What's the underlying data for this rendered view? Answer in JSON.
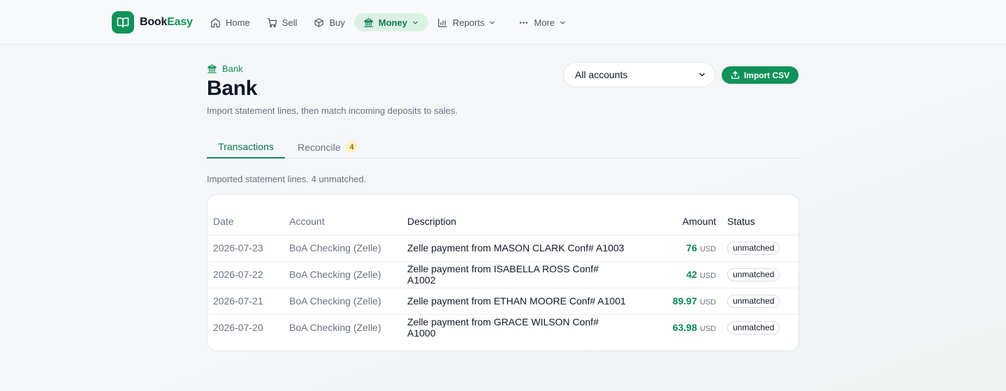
{
  "brand": {
    "name_part1": "Book",
    "name_part2": "Easy"
  },
  "nav": {
    "home": "Home",
    "sell": "Sell",
    "buy": "Buy",
    "money": "Money",
    "reports": "Reports",
    "more": "More"
  },
  "header": {
    "breadcrumb": "Bank",
    "title": "Bank",
    "subtitle": "Import statement lines, then match incoming deposits to sales.",
    "account_select": "All accounts",
    "import_button": "Import CSV"
  },
  "tabs": {
    "transactions": "Transactions",
    "reconcile": "Reconcile",
    "reconcile_count": "4"
  },
  "summary": "Imported statement lines. 4 unmatched.",
  "table": {
    "headers": {
      "date": "Date",
      "account": "Account",
      "description": "Description",
      "amount": "Amount",
      "status": "Status"
    },
    "rows": [
      {
        "date": "2026-07-23",
        "account": "BoA Checking (Zelle)",
        "description": "Zelle payment from MASON CLARK Conf# A1003",
        "amount": "76",
        "currency": "USD",
        "status": "unmatched"
      },
      {
        "date": "2026-07-22",
        "account": "BoA Checking (Zelle)",
        "description": "Zelle payment from ISABELLA ROSS Conf# A1002",
        "amount": "42",
        "currency": "USD",
        "status": "unmatched"
      },
      {
        "date": "2026-07-21",
        "account": "BoA Checking (Zelle)",
        "description": "Zelle payment from ETHAN MOORE Conf# A1001",
        "amount": "89.97",
        "currency": "USD",
        "status": "unmatched"
      },
      {
        "date": "2026-07-20",
        "account": "BoA Checking (Zelle)",
        "description": "Zelle payment from GRACE WILSON Conf# A1000",
        "amount": "63.98",
        "currency": "USD",
        "status": "unmatched"
      }
    ]
  },
  "colors": {
    "accent": "#10925a",
    "accent_soft": "#dcf1e5",
    "badge": "#fdf3c7"
  }
}
